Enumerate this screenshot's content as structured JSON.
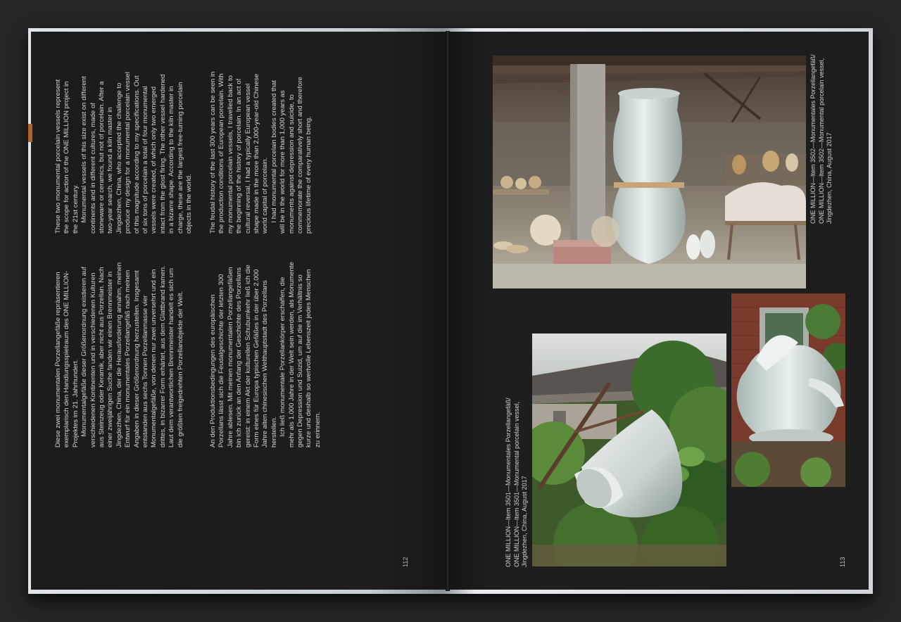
{
  "left_page": {
    "german_column_1": [
      "Diese zwei monumentalen Porzellangefäße repräsentieren exemplarisch den Handlungsspielraum des ONE MILLION-Projektes im 21. Jahrhundert.",
      "Monumentalgefäße dieser Größenordnung existieren auf verschiedenen Kontinenten und in verschiedenen Kulturen aus Steinzeug oder Keramik, aber nicht aus Porzellan. Nach einer zweijährigen Suche fanden wir einen Brennmeister in Jingdezhen, China, der die Herausforderung annahm, meinen Entwurf für ein monumentales Porzellangefäß nach meinen Angaben in dieser Größenordnung herzustellen. Insgesamt entstanden aus sechs Tonnen Porzellanmasse vier Monumentalgefäße, von denen nur zwei unversehrt und ein drittes, in bizarrer Form erhärtet, aus dem Glattbrand kamen. Laut dem verantwortlichen Brennmeister handelt es sich um die größten freigedrehten Porzellanobjekte der Welt."
    ],
    "german_column_2": [
      "An den Produktionsbedingungen des europäischen Porzellans lässt sich die Feudalgeschichte der letzten 300 Jahre ablesen. Mit meinen monumentalen Porzellangefäßen bin ich zurück an den Anfang der Geschichte des Porzellans gereist: in einem Akt der kulturellen Schubumkehr ließ ich die Form eines für Europa typischen Gefäßes in der über 2.000 Jahre alten chinesischen Welthauptstadt des Porzellans herstellen.",
      "Ich ließ monumentale Porzellankörper erschaffen, die mehr als 1.000 Jahre in der Welt sein werden, als Monumente gegen Depression und Suizid, um auf die im Verhältnis so kurze und deshalb so wertvolle Lebenszeit jedes Menschen zu erinnern."
    ],
    "english_column_1": [
      "These two monumental porcelain vessels represent the scope for action of the ONE MILLION project in the 21st century.",
      "Monumental vessels of this size exist on different continents and in different cultures, made of stoneware or ceramics, but not of porcelain. After a two-year search, we found a kiln master in Jingdezhen, China, who accepted the challenge to produce my design for a monumental porcelain vessel of this magnitude according to my specifications. Out of six tons of porcelain a total of four monumental vessels were created, of which only two emerged intact from the glost firing. The other vessel hardened in a bizarre shape. According to the kiln master in charge, these are the largest free-turning porcelain objects in the world."
    ],
    "english_column_2": [
      "The feudal history of the last 300 years can be seen in the production conditions of European porcelain. With my monumental porcelain vessels, I travelled back to the beginning of the history of porcelain. In an act of cultural reversal, I had a typically European vessel shape made in the more than 2,000-year-old Chinese world capital of porcelain.",
      "I had monumental porcelain bodies created that will be in the world for more than 1,000 years as monuments against depression and suicide, to commemorate the comparatively short and therefore precious lifetime of every human being."
    ],
    "page_number": "112"
  },
  "right_page": {
    "caption_3501": [
      "ONE MILLION—Item 3501—Monumentales Porzellangefäß/",
      "ONE MILLION—Item 3501—Monumental porcelain vessel,",
      "Jingdezhen, China, August 2017"
    ],
    "caption_3502": [
      "ONE MILLION—Item 3502—Monumentales Porzellangefäß/",
      "ONE MILLION—Item 3502—Monumental porcelain vessel,",
      "Jingdezhen, China, August 2017"
    ],
    "page_number": "113"
  },
  "colors": {
    "page": "#1d1d1d",
    "text": "#d4d4d4",
    "bookmark": "#b0652a",
    "porcelain": "#dfe6e3"
  }
}
